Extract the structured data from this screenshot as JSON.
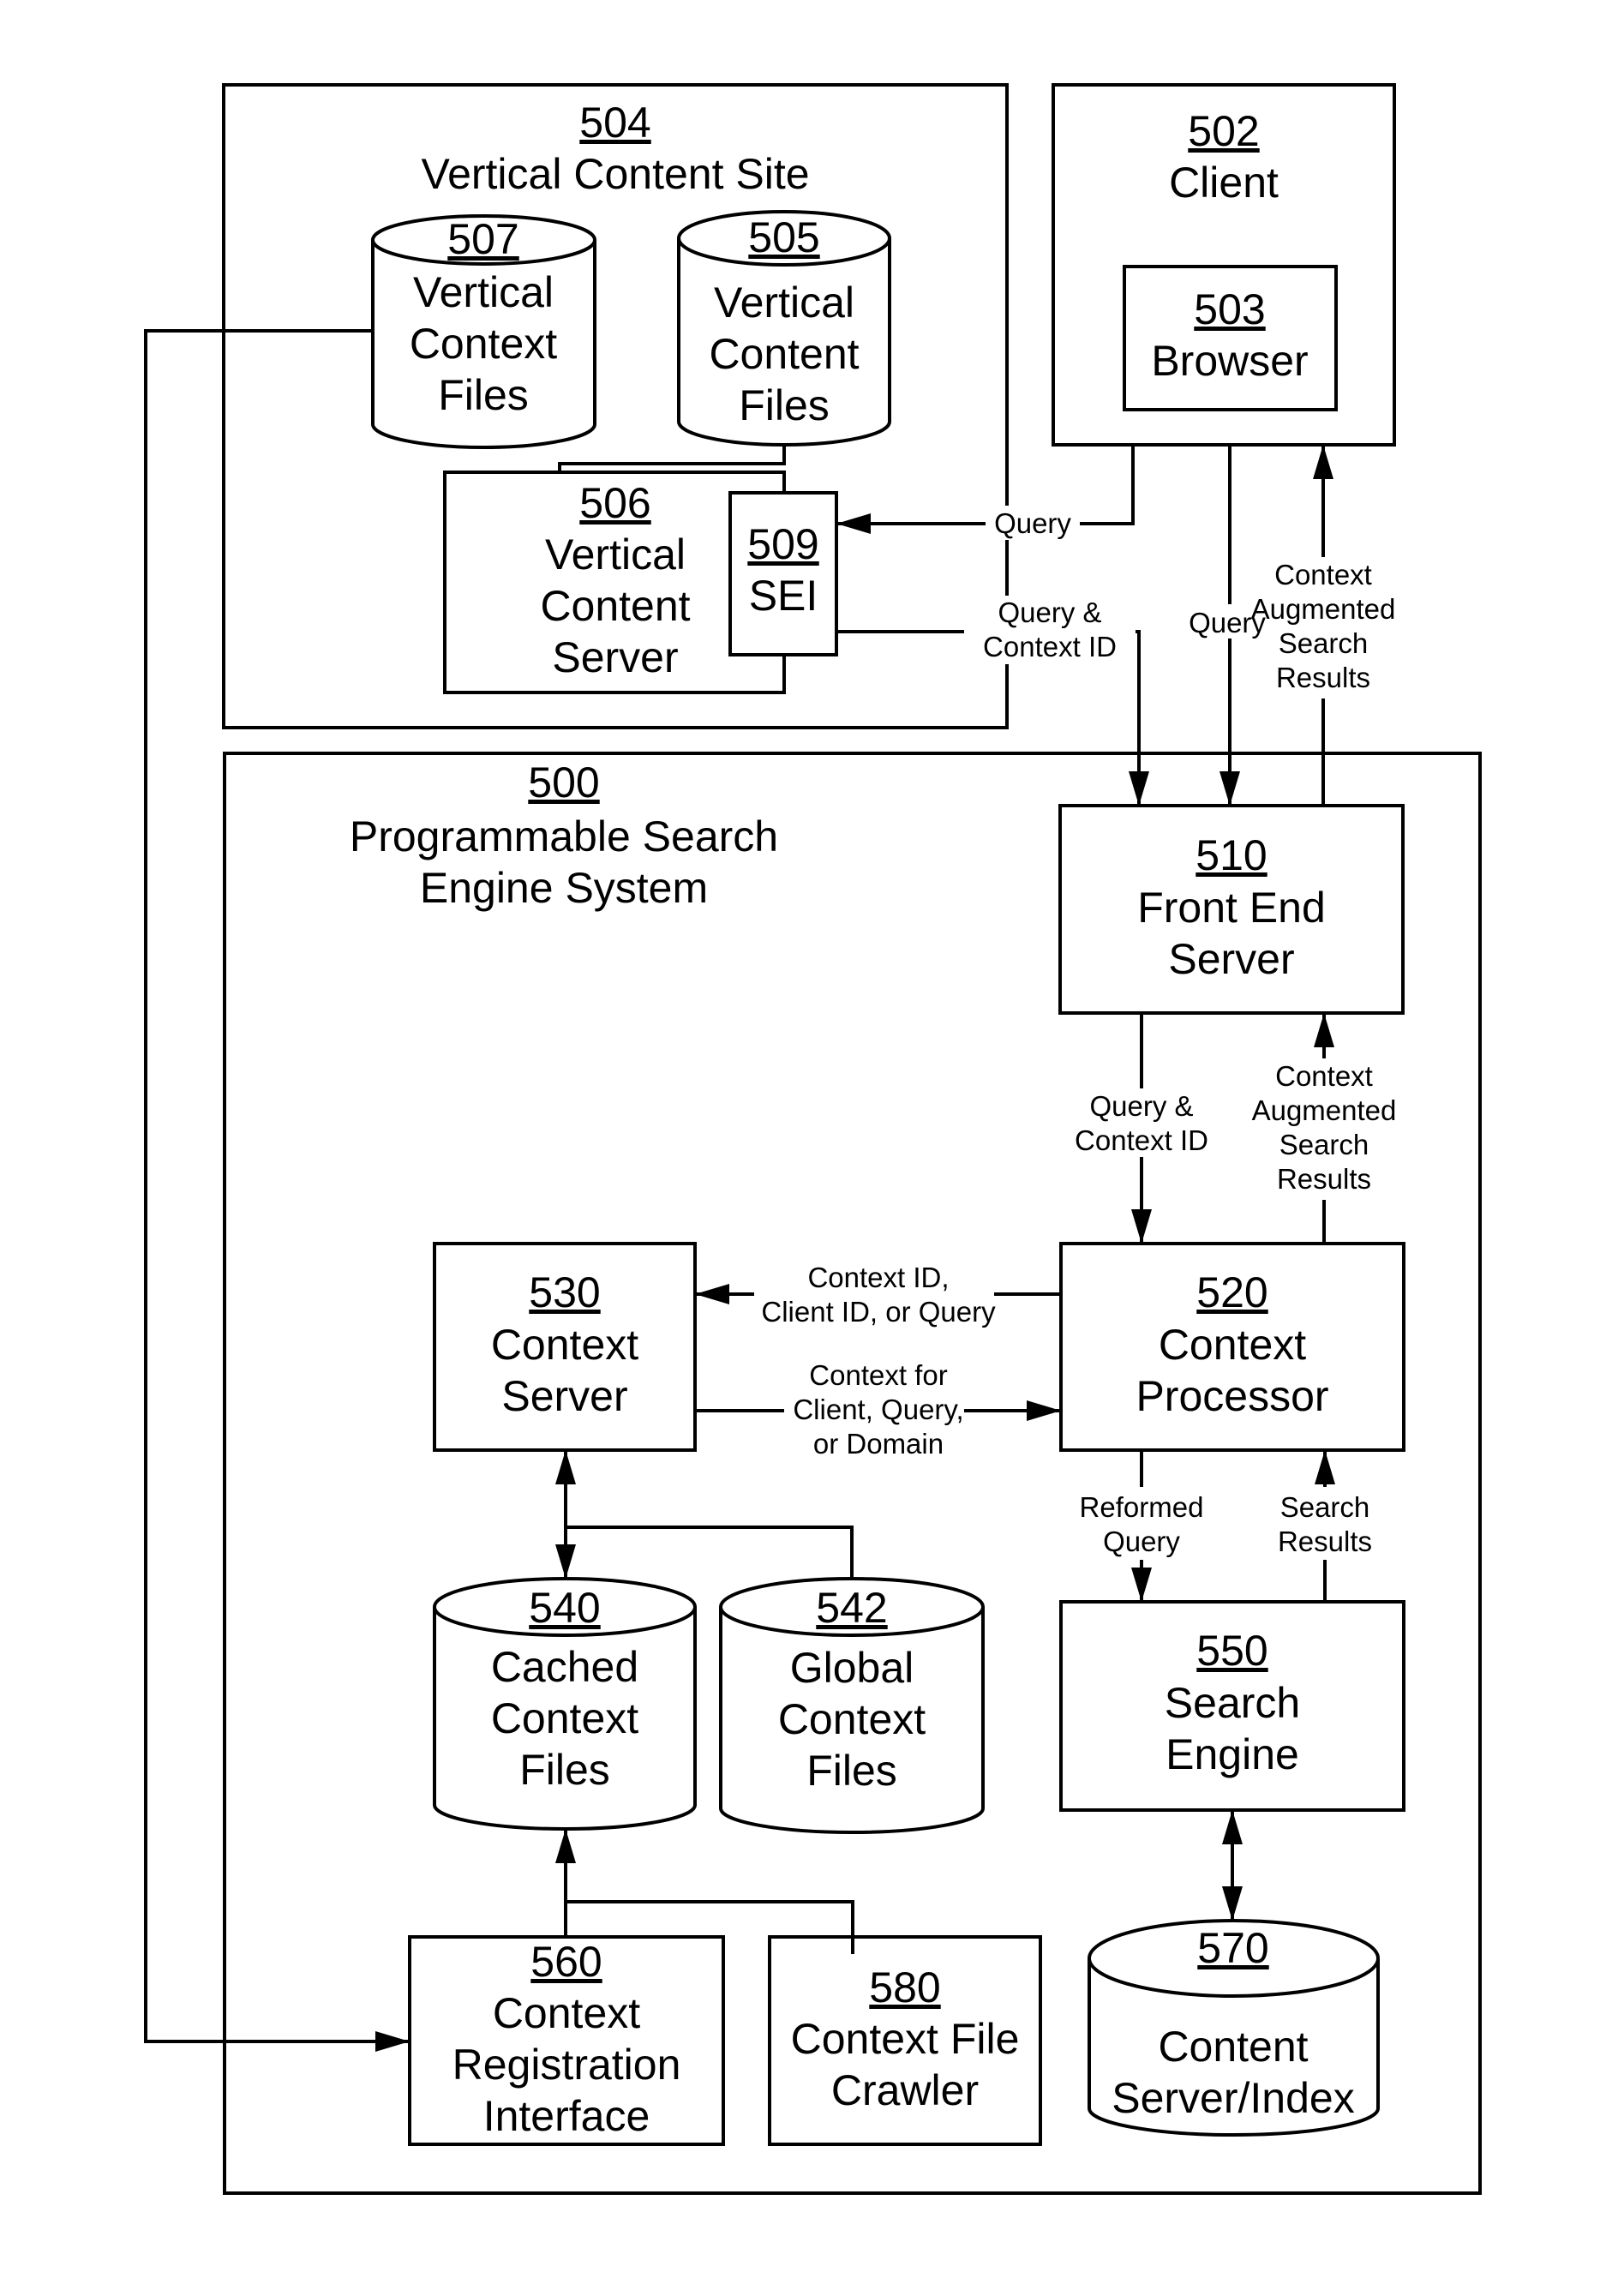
{
  "diagram": {
    "title": "Programmable Search Engine System block diagram",
    "nodes": [
      {
        "id": "504",
        "number": "504",
        "lines": [
          "Vertical Content Site"
        ],
        "shape": "container"
      },
      {
        "id": "502",
        "number": "502",
        "lines": [
          "Client"
        ],
        "shape": "container"
      },
      {
        "id": "503",
        "number": "503",
        "lines": [
          "Browser"
        ],
        "shape": "box"
      },
      {
        "id": "507",
        "number": "507",
        "lines": [
          "Vertical",
          "Context",
          "Files"
        ],
        "shape": "cylinder"
      },
      {
        "id": "505",
        "number": "505",
        "lines": [
          "Vertical",
          "Content",
          "Files"
        ],
        "shape": "cylinder"
      },
      {
        "id": "506",
        "number": "506",
        "lines": [
          "Vertical",
          "Content",
          "Server"
        ],
        "shape": "box"
      },
      {
        "id": "509",
        "number": "509",
        "lines": [
          "SEI"
        ],
        "shape": "box"
      },
      {
        "id": "500",
        "number": "500",
        "lines": [
          "Programmable Search",
          "Engine System"
        ],
        "shape": "container"
      },
      {
        "id": "510",
        "number": "510",
        "lines": [
          "Front End",
          "Server"
        ],
        "shape": "box"
      },
      {
        "id": "520",
        "number": "520",
        "lines": [
          "Context",
          "Processor"
        ],
        "shape": "box"
      },
      {
        "id": "530",
        "number": "530",
        "lines": [
          "Context",
          "Server"
        ],
        "shape": "box"
      },
      {
        "id": "540",
        "number": "540",
        "lines": [
          "Cached",
          "Context",
          "Files"
        ],
        "shape": "cylinder"
      },
      {
        "id": "542",
        "number": "542",
        "lines": [
          "Global",
          "Context",
          "Files"
        ],
        "shape": "cylinder"
      },
      {
        "id": "550",
        "number": "550",
        "lines": [
          "Search",
          "Engine"
        ],
        "shape": "box"
      },
      {
        "id": "560",
        "number": "560",
        "lines": [
          "Context",
          "Registration",
          "Interface"
        ],
        "shape": "box"
      },
      {
        "id": "570",
        "number": "570",
        "lines": [
          "Content",
          "Server/Index"
        ],
        "shape": "cylinder"
      },
      {
        "id": "580",
        "number": "580",
        "lines": [
          "Context File",
          "Crawler"
        ],
        "shape": "box"
      }
    ],
    "edges": [
      {
        "id": "e1",
        "from": "502",
        "to": "509",
        "label": [
          "Query"
        ]
      },
      {
        "id": "e2",
        "from": "509",
        "to": "510",
        "label": [
          "Query &",
          "Context ID"
        ]
      },
      {
        "id": "e3",
        "from": "503",
        "to": "510",
        "label": [
          "Query"
        ]
      },
      {
        "id": "e4",
        "from": "510",
        "to": "502",
        "label": [
          "Context",
          "Augmented",
          "Search",
          "Results"
        ]
      },
      {
        "id": "e5",
        "from": "510",
        "to": "520",
        "label": [
          "Query &",
          "Context ID"
        ]
      },
      {
        "id": "e6",
        "from": "520",
        "to": "510",
        "label": [
          "Context",
          "Augmented",
          "Search",
          "Results"
        ]
      },
      {
        "id": "e7",
        "from": "520",
        "to": "530",
        "label": [
          "Context ID,",
          "Client ID, or Query"
        ]
      },
      {
        "id": "e8",
        "from": "530",
        "to": "520",
        "label": [
          "Context for",
          "Client, Query,",
          "or Domain"
        ]
      },
      {
        "id": "e9",
        "from": "520",
        "to": "550",
        "label": [
          "Reformed",
          "Query"
        ]
      },
      {
        "id": "e10",
        "from": "550",
        "to": "520",
        "label": [
          "Search",
          "Results"
        ]
      },
      {
        "id": "e11",
        "from": "530",
        "to": "540",
        "label": [],
        "bidirectional": true
      },
      {
        "id": "e12",
        "from": "542",
        "to": "530",
        "label": []
      },
      {
        "id": "e13",
        "from": "560",
        "to": "540",
        "label": []
      },
      {
        "id": "e14",
        "from": "580",
        "to": "540",
        "label": []
      },
      {
        "id": "e15",
        "from": "507",
        "to": "560",
        "label": []
      },
      {
        "id": "e16",
        "from": "550",
        "to": "570",
        "label": [],
        "bidirectional": true
      },
      {
        "id": "e17",
        "from": "505",
        "to": "506",
        "label": []
      }
    ]
  }
}
